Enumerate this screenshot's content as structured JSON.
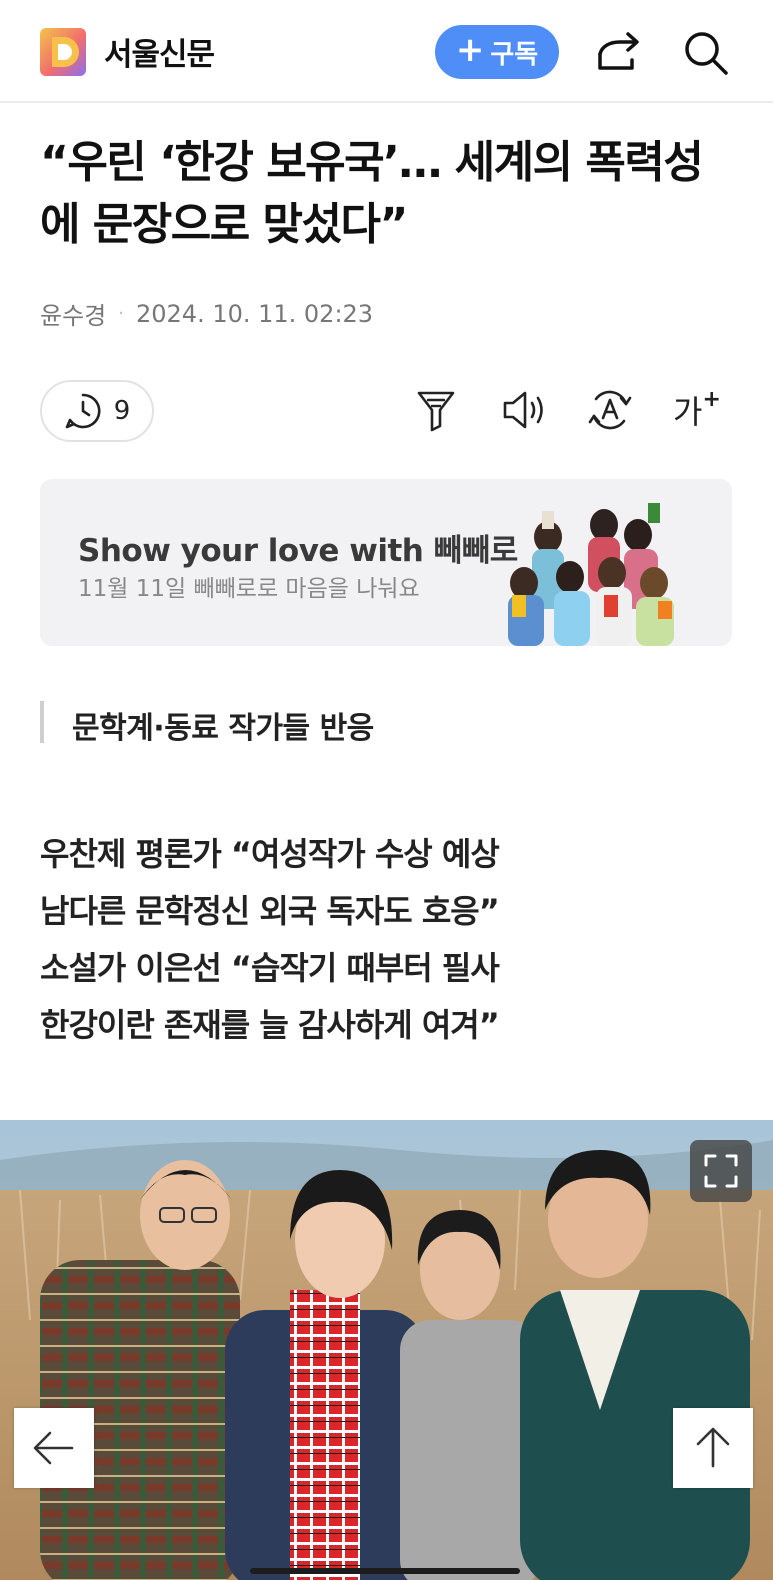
{
  "header": {
    "logo_letter": "D",
    "brand": "서울신문",
    "subscribe_label": "구독",
    "share_icon": "share-icon",
    "search_icon": "search-icon",
    "accent_color": "#4f8df7"
  },
  "article": {
    "headline": "“우린 ‘한강 보유국’… 세계의 폭력성에 문장으로 맞섰다”",
    "author": "윤수경",
    "timestamp": "2024. 10. 11. 02:23"
  },
  "toolbar": {
    "comment_count": "9",
    "icons": [
      "comment-clock-icon",
      "summary-funnel-icon",
      "speaker-icon",
      "translate-icon",
      "font-size-icon"
    ],
    "font_size_label": "가"
  },
  "ad": {
    "title": "Show your love with 빼빼로",
    "subtitle": "11월 11일 빼빼로로 마음을 나눠요"
  },
  "subheading": "문학계·동료 작가들 반응",
  "summary": {
    "lines": [
      "우찬제 평론가 “여성작가 수상 예상",
      "남다른 문학정신 외국 독자도 호응”",
      "소설가 이은선 “습작기 때부터 필사",
      "한강이란 존재를 늘 감사하게 여겨”"
    ]
  },
  "photo": {
    "expand_icon": "expand-icon"
  },
  "nav": {
    "back_icon": "arrow-left-icon",
    "top_icon": "arrow-up-icon"
  }
}
